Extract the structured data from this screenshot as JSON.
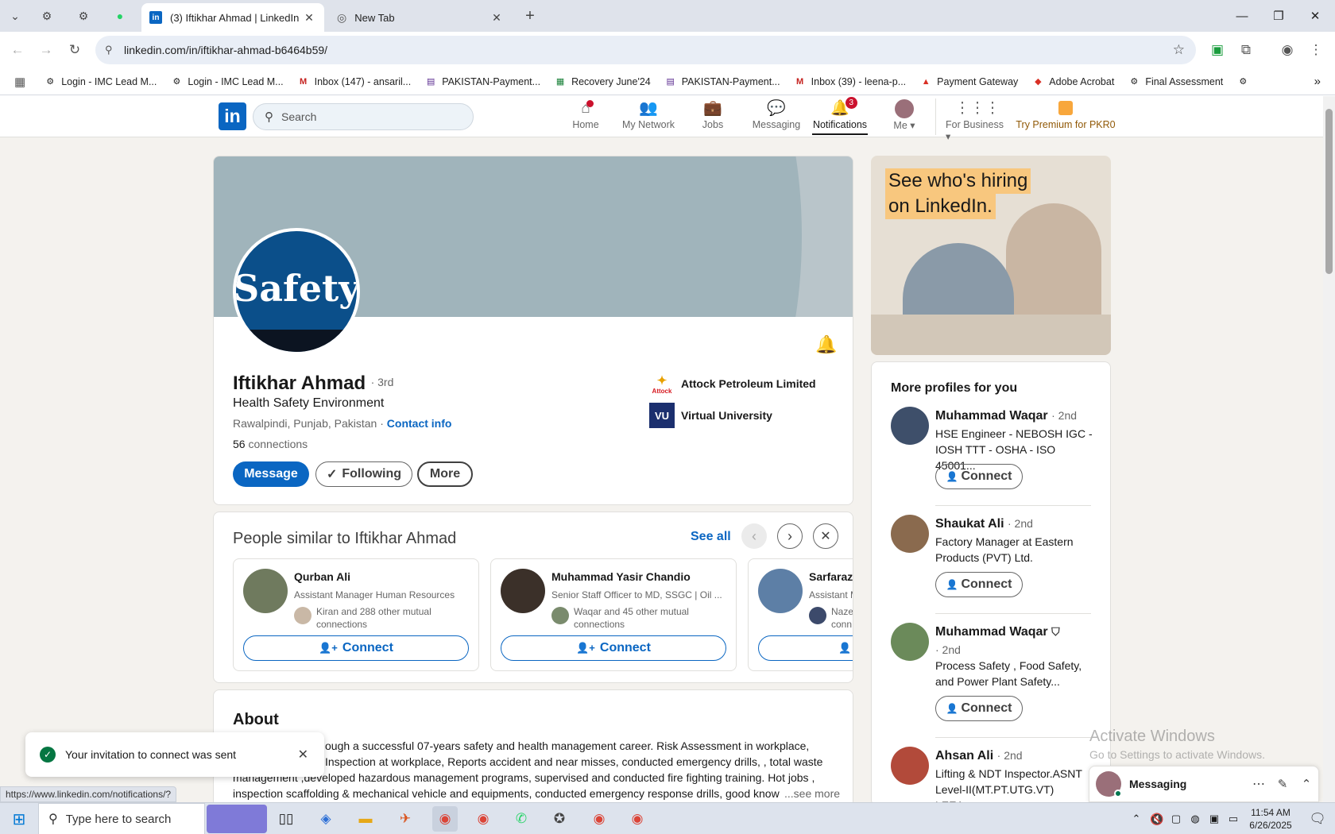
{
  "browser": {
    "tabs": [
      {
        "title": "(3) Iftikhar Ahmad | LinkedIn",
        "active": true
      },
      {
        "title": "New Tab",
        "active": false
      }
    ],
    "url": "linkedin.com/in/iftikhar-ahmad-b6464b59/",
    "bookmarks": [
      "Login - IMC Lead M...",
      "Login - IMC Lead M...",
      "Inbox (147) - ansaril...",
      "PAKISTAN-Payment...",
      "Recovery June'24",
      "PAKISTAN-Payment...",
      "Inbox (39) - leena-p...",
      "Payment Gateway",
      "Adobe Acrobat",
      "Final Assessment"
    ]
  },
  "linkedin_header": {
    "search_placeholder": "Search",
    "nav": {
      "home": "Home",
      "network": "My Network",
      "jobs": "Jobs",
      "messaging": "Messaging",
      "notifications": "Notifications",
      "notifications_badge": "3",
      "me": "Me",
      "business": "For Business",
      "premium": "Try Premium for PKR0"
    }
  },
  "profile": {
    "avatar_text": "Safety",
    "name": "Iftikhar Ahmad",
    "degree": "· 3rd",
    "headline": "Health Safety Environment",
    "location": "Rawalpindi, Punjab, Pakistan",
    "location_sep": "·",
    "contact_info": "Contact info",
    "connections_count": "56",
    "connections_label": "connections",
    "companies": [
      {
        "name": "Attock Petroleum Limited",
        "logo_text": "Attock"
      },
      {
        "name": "Virtual University",
        "logo_text": "VU"
      }
    ],
    "buttons": {
      "message": "Message",
      "following": "Following",
      "more": "More"
    }
  },
  "similar": {
    "title": "People similar to Iftikhar Ahmad",
    "see_all": "See all",
    "people": [
      {
        "name": "Qurban Ali",
        "headline": "Assistant Manager Human Resources",
        "mutual": "Kiran and 288 other mutual connections",
        "connect": "Connect"
      },
      {
        "name": "Muhammad Yasir Chandio",
        "headline": "Senior Staff Officer to MD, SSGC | Oil ...",
        "mutual": "Waqar and 45 other mutual connections",
        "connect": "Connect"
      },
      {
        "name": "Sarfaraz",
        "headline": "Assistant M",
        "mutual": "Nazee conn",
        "connect": ""
      }
    ]
  },
  "about": {
    "title": "About",
    "line1": "ough a successful 07-years safety and health management career. Risk Assessment in workplace,",
    "line2": "Inspection at workplace, Reports accident and near misses, conducted emergency drills, , total waste",
    "line3": "management ,developed hazardous management programs, supervised and conducted fire fighting training. Hot jobs ,",
    "line4": "inspection scaffolding & mechanical vehicle and equipments, conducted emergency response drills, good know",
    "see_more": "...see more"
  },
  "ad": {
    "line1": "See who's hiring",
    "line2": "on LinkedIn."
  },
  "more_profiles": {
    "title": "More profiles for you",
    "people": [
      {
        "name": "Muhammad Waqar",
        "degree": "· 2nd",
        "headline": "HSE Engineer - NEBOSH IGC - IOSH TTT - OSHA - ISO 45001...",
        "connect": "Connect"
      },
      {
        "name": "Shaukat Ali",
        "degree": "· 2nd",
        "headline": "Factory Manager at Eastern Products (PVT) Ltd.",
        "connect": "Connect"
      },
      {
        "name": "Muhammad Waqar",
        "degree": "· 2nd",
        "headline": "Process Safety , Food Safety, and Power Plant Safety...",
        "connect": "Connect"
      },
      {
        "name": "Ahsan Ali",
        "degree": "· 2nd",
        "headline": "Lifting & NDT Inspector.ASNT Level-II(MT.PT.UTG.VT) LEEA...",
        "connect": ""
      }
    ]
  },
  "toast": {
    "text": "Your invitation to connect was sent"
  },
  "messaging_bar": {
    "label": "Messaging"
  },
  "watermark": {
    "line1": "Activate Windows",
    "line2": "Go to Settings to activate Windows."
  },
  "status_url": "https://www.linkedin.com/notifications/?",
  "taskbar": {
    "search_placeholder": "Type here to search",
    "time": "11:54 AM",
    "date": "6/26/2025"
  },
  "colors": {
    "linkedin_blue": "#0a66c2",
    "badge_red": "#cb112d",
    "page_bg": "#f4f2ee"
  }
}
